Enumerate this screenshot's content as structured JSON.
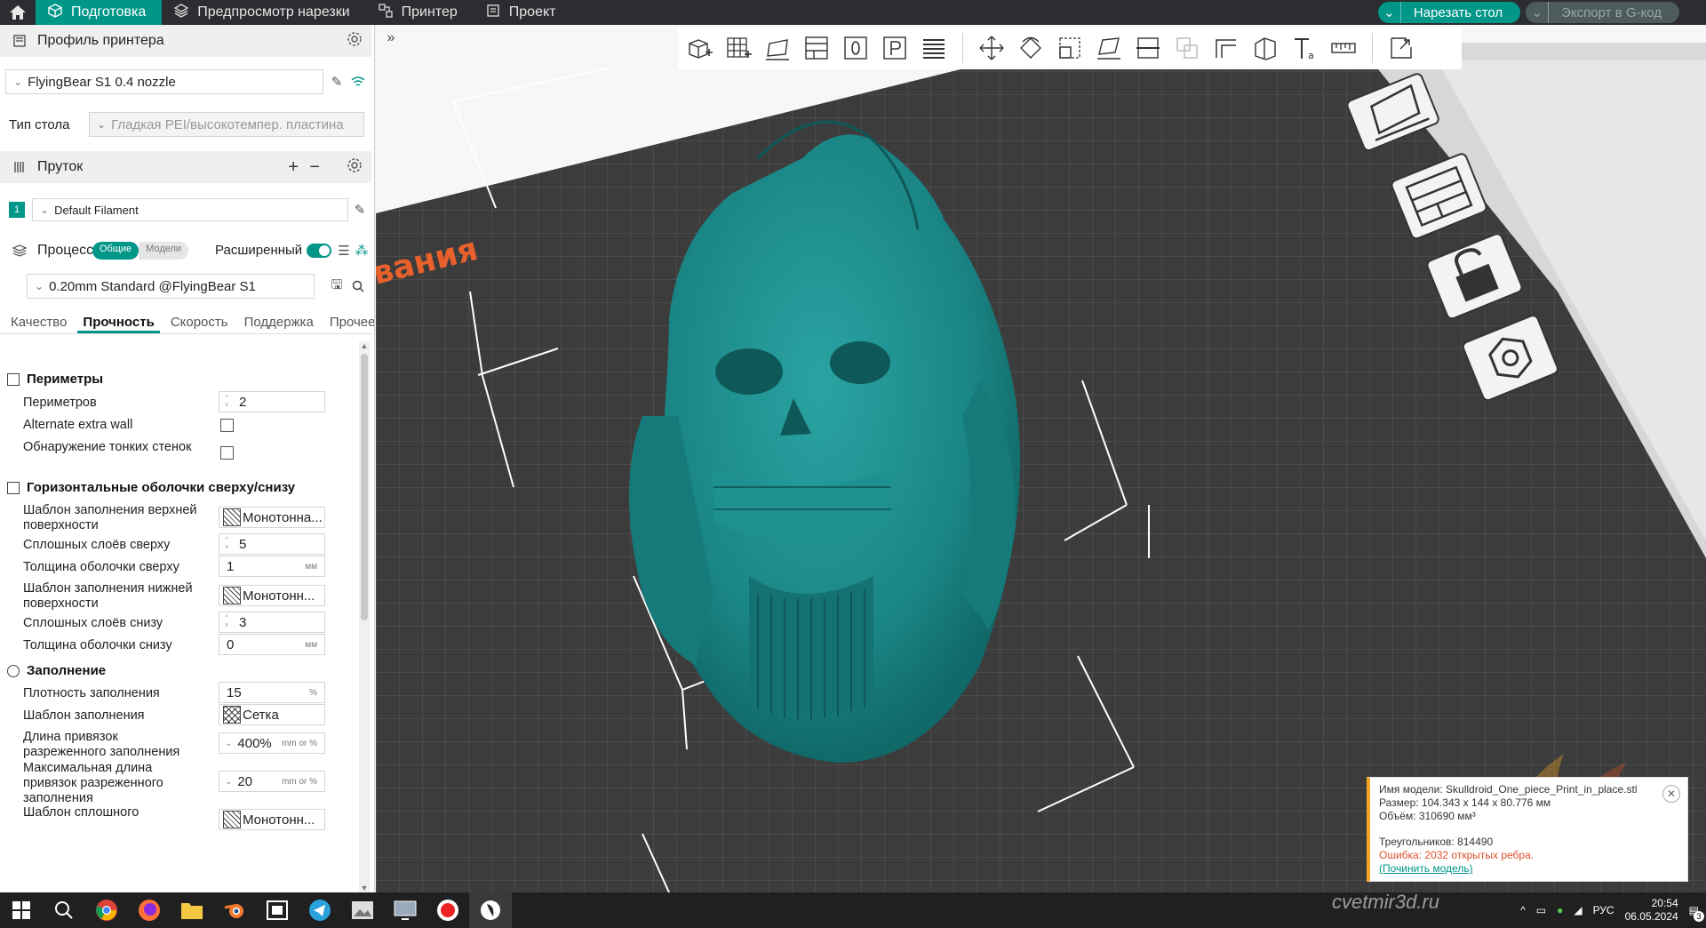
{
  "topbar": {
    "tabs": [
      {
        "label": "Подготовка",
        "active": true
      },
      {
        "label": "Предпросмотр нарезки",
        "active": false
      },
      {
        "label": "Принтер",
        "active": false
      },
      {
        "label": "Проект",
        "active": false
      }
    ],
    "slice_label": "Нарезать стол",
    "export_label": "Экспорт в G-код"
  },
  "printer": {
    "section_title": "Профиль принтера",
    "selected": "FlyingBear S1 0.4 nozzle",
    "bed_label": "Тип стола",
    "bed_value": "Гладкая PEI/высокотемпер. пластина"
  },
  "filament": {
    "section_title": "Пруток",
    "index": "1",
    "selected": "Default Filament"
  },
  "process": {
    "section_title": "Процесс",
    "pill_global": "Общие",
    "pill_objects": "Модели",
    "advanced_label": "Расширенный",
    "selected": "0.20mm Standard @FlyingBear S1",
    "tabs": [
      "Качество",
      "Прочность",
      "Скорость",
      "Поддержка",
      "Прочее"
    ],
    "active_tab": "Прочность"
  },
  "settings": {
    "walls_group": "Периметры",
    "walls_label": "Периметров",
    "walls_value": "2",
    "alt_wall_label": "Alternate extra wall",
    "thin_wall_label": "Обнаружение тонких стенок",
    "shells_group": "Горизонтальные оболочки сверху/снизу",
    "top_pattern_label": "Шаблон заполнения верхней поверхности",
    "top_pattern_value": "Монотонна...",
    "top_layers_label": "Сплошных слоёв сверху",
    "top_layers_value": "5",
    "top_thick_label": "Толщина оболочки сверху",
    "top_thick_value": "1",
    "unit_mm": "мм",
    "bottom_pattern_label": "Шаблон заполнения нижней поверхности",
    "bottom_pattern_value": "Монотонн...",
    "bottom_layers_label": "Сплошных слоёв снизу",
    "bottom_layers_value": "3",
    "bottom_thick_label": "Толщина оболочки снизу",
    "bottom_thick_value": "0",
    "infill_group": "Заполнение",
    "density_label": "Плотность заполнения",
    "density_value": "15",
    "unit_percent": "%",
    "infill_pattern_label": "Шаблон заполнения",
    "infill_pattern_value": "Сетка",
    "anchor_label": "Длина привязок разреженного заполнения",
    "anchor_value": "400%",
    "anchor_unit": "mm or %",
    "anchor_max_label": "Максимальная длина привязок разреженного заполнения",
    "anchor_max_value": "20",
    "solid_pattern_label": "Шаблон сплошного",
    "solid_pattern_value": "Монотонн..."
  },
  "viewport": {
    "bed_text": "вания"
  },
  "info": {
    "name": "Имя модели: Skulldroid_One_piece_Print_in_place.stl",
    "size": "Размер: 104.343 x 144 x 80.776 мм",
    "volume": "Объём: 310690 мм³",
    "triangles": "Треугольников: 814490",
    "error": "Ошибка: 2032 открытых ребра.",
    "fix": "(Починить модель)"
  },
  "taskbar": {
    "lang": "РУС",
    "time": "20:54",
    "date": "06.05.2024",
    "notif": "3",
    "watermark": "cvetmir3d.ru"
  },
  "colors": {
    "accent": "#009688",
    "model": "#1c8a8a",
    "bed": "#3a3a3a",
    "error": "#e0502a"
  }
}
